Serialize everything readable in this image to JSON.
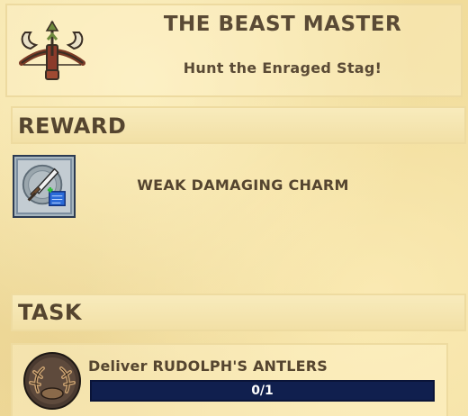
{
  "quest": {
    "title": "THE BEAST MASTER",
    "subtitle": "Hunt the Enraged Stag!",
    "icon": "crossbow-antlers-icon"
  },
  "reward": {
    "section_label": "REWARD",
    "item_name": "WEAK DAMAGING CHARM",
    "item_icon": "sword-charm-icon"
  },
  "task": {
    "section_label": "TASK",
    "text": "Deliver RUDOLPH'S ANTLERS",
    "icon": "antlers-icon",
    "progress_label": "0/1",
    "progress_fraction": 0
  },
  "colors": {
    "parchment": "#f3e1a3",
    "text": "#55452f",
    "progress_bg": "#101f4e"
  }
}
